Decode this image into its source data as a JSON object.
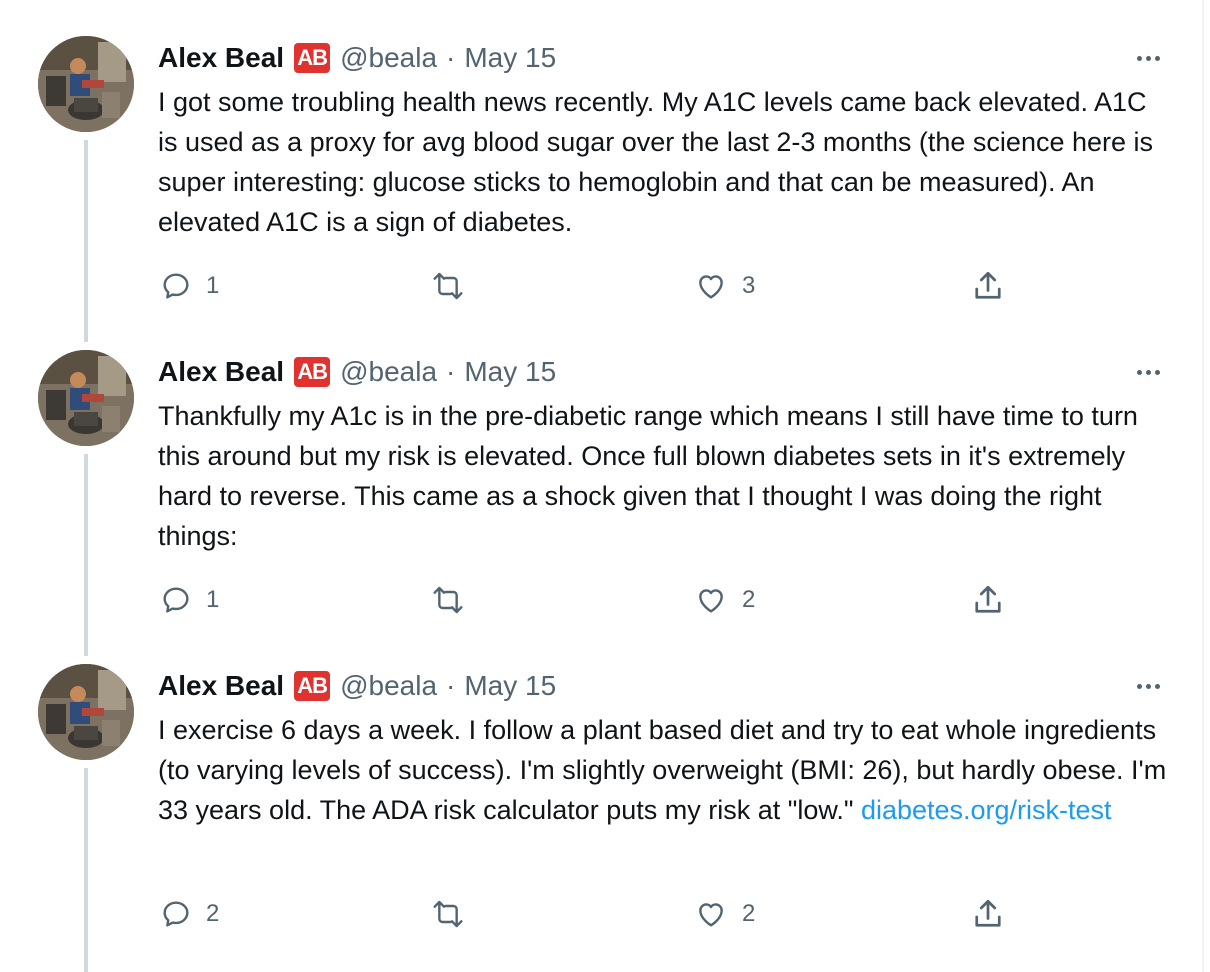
{
  "author": {
    "name": "Alex Beal",
    "badge": "AB",
    "handle": "@beala",
    "separator": "·",
    "avatar_icon": "avatar-photo-icon"
  },
  "colors": {
    "text": "#0f1419",
    "secondary": "#536471",
    "link": "#1d9bf0",
    "badge": "#e0332f",
    "thread_line": "#cfd9de"
  },
  "tweets": [
    {
      "date": "May 15",
      "text": "I got some troubling health news recently. My A1C levels came back elevated. A1C is used as a proxy for avg blood sugar over the last 2-3 months (the science here is super interesting: glucose sticks to hemoglobin and that can be measured). An elevated A1C is a sign of diabetes.",
      "link": "",
      "replies": "1",
      "retweets": "",
      "likes": "3"
    },
    {
      "date": "May 15",
      "text": "Thankfully my A1c is in the pre-diabetic range which means I still have time to turn this around but my risk is elevated. Once full blown diabetes sets in it's extremely hard to reverse. This came as a shock given that I thought I was doing the right things:",
      "link": "",
      "replies": "1",
      "retweets": "",
      "likes": "2"
    },
    {
      "date": "May 15",
      "text": "I exercise 6 days a week. I follow a plant based diet and try to eat whole ingredients (to varying levels of success). I'm slightly overweight (BMI: 26), but hardly obese. I'm 33 years old. The ADA risk calculator puts my risk at \"low.\" ",
      "link": "diabetes.org/risk-test",
      "replies": "2",
      "retweets": "",
      "likes": "2"
    }
  ],
  "icons": {
    "reply": "reply-icon",
    "retweet": "retweet-icon",
    "like": "heart-icon",
    "share": "share-icon",
    "more": "more-options-icon"
  }
}
